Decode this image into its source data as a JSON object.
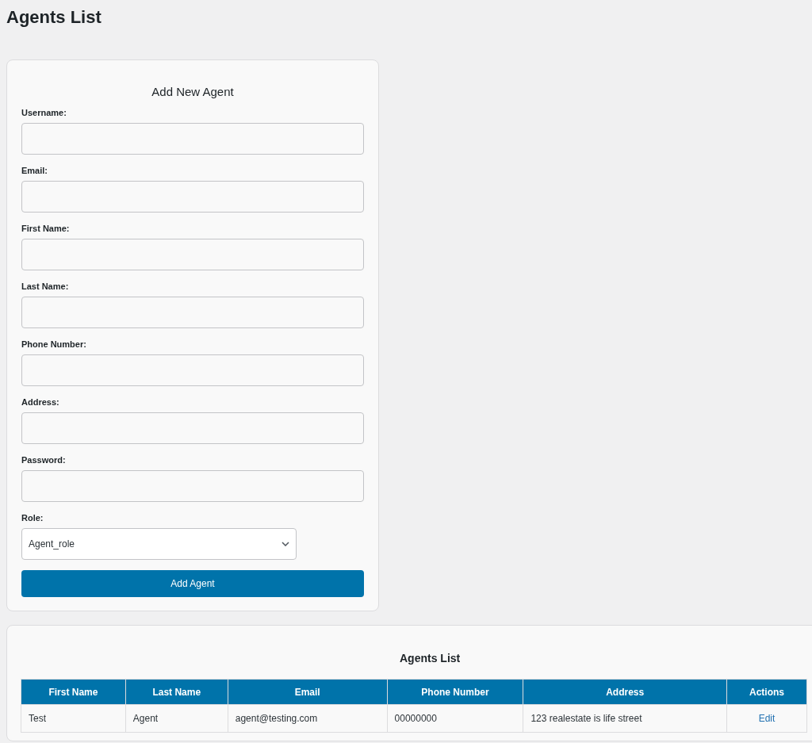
{
  "page_title": "Agents List",
  "form": {
    "title": "Add New Agent",
    "fields": [
      {
        "label": "Username:",
        "kind": "text"
      },
      {
        "label": "Email:",
        "kind": "text"
      },
      {
        "label": "First Name:",
        "kind": "text"
      },
      {
        "label": "Last Name:",
        "kind": "text"
      },
      {
        "label": "Phone Number:",
        "kind": "text"
      },
      {
        "label": "Address:",
        "kind": "text"
      },
      {
        "label": "Password:",
        "kind": "password"
      },
      {
        "label": "Role:",
        "kind": "select",
        "value": "Agent_role"
      }
    ],
    "submit": "Add Agent"
  },
  "table": {
    "title": "Agents List",
    "columns": [
      "First Name",
      "Last Name",
      "Email",
      "Phone Number",
      "Address",
      "Actions"
    ],
    "rows": [
      {
        "cells": [
          "Test",
          "Agent",
          "agent@testing.com",
          "00000000",
          "123 realestate is life street"
        ],
        "action": "Edit"
      }
    ]
  }
}
